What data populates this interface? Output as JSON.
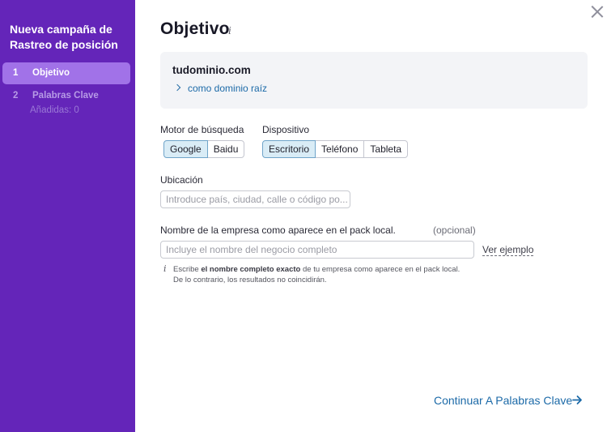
{
  "sidebar": {
    "title": "Nueva campaña de Rastreo de posición",
    "steps": [
      {
        "number": "1",
        "label": "Objetivo"
      },
      {
        "number": "2",
        "label": "Palabras Clave",
        "sub": "Añadidas: 0"
      }
    ],
    "bg_color": "#6425b9",
    "active_color": "#a172e8"
  },
  "header": {
    "title": "Objetivo",
    "info_glyph": "i"
  },
  "target": {
    "domain": "tudominio.com",
    "scope": "como dominio raíz"
  },
  "engine": {
    "label": "Motor de búsqueda",
    "options": [
      "Google",
      "Baidu"
    ],
    "selected": "Google"
  },
  "device": {
    "label": "Dispositivo",
    "options": [
      "Escritorio",
      "Teléfono",
      "Tableta"
    ],
    "selected": "Escritorio"
  },
  "location": {
    "label": "Ubicación",
    "placeholder": "Introduce país, ciudad, calle o código po..."
  },
  "business": {
    "label": "Nombre de la empresa como aparece en el pack local.",
    "optional": "(opcional)",
    "placeholder": "Incluye el nombre del negocio completo",
    "example_link": "Ver ejemplo",
    "hint_pre": "Escribe ",
    "hint_bold": "el nombre completo exacto",
    "hint_post": " de tu empresa como aparece en el pack local.",
    "hint_line2": "De lo contrario, los resultados no coincidirán."
  },
  "footer": {
    "continue_label": "Continuar A Palabras Clave"
  },
  "colors": {
    "link": "#1c6aa8",
    "selected_segment": "#d9ecf6"
  }
}
